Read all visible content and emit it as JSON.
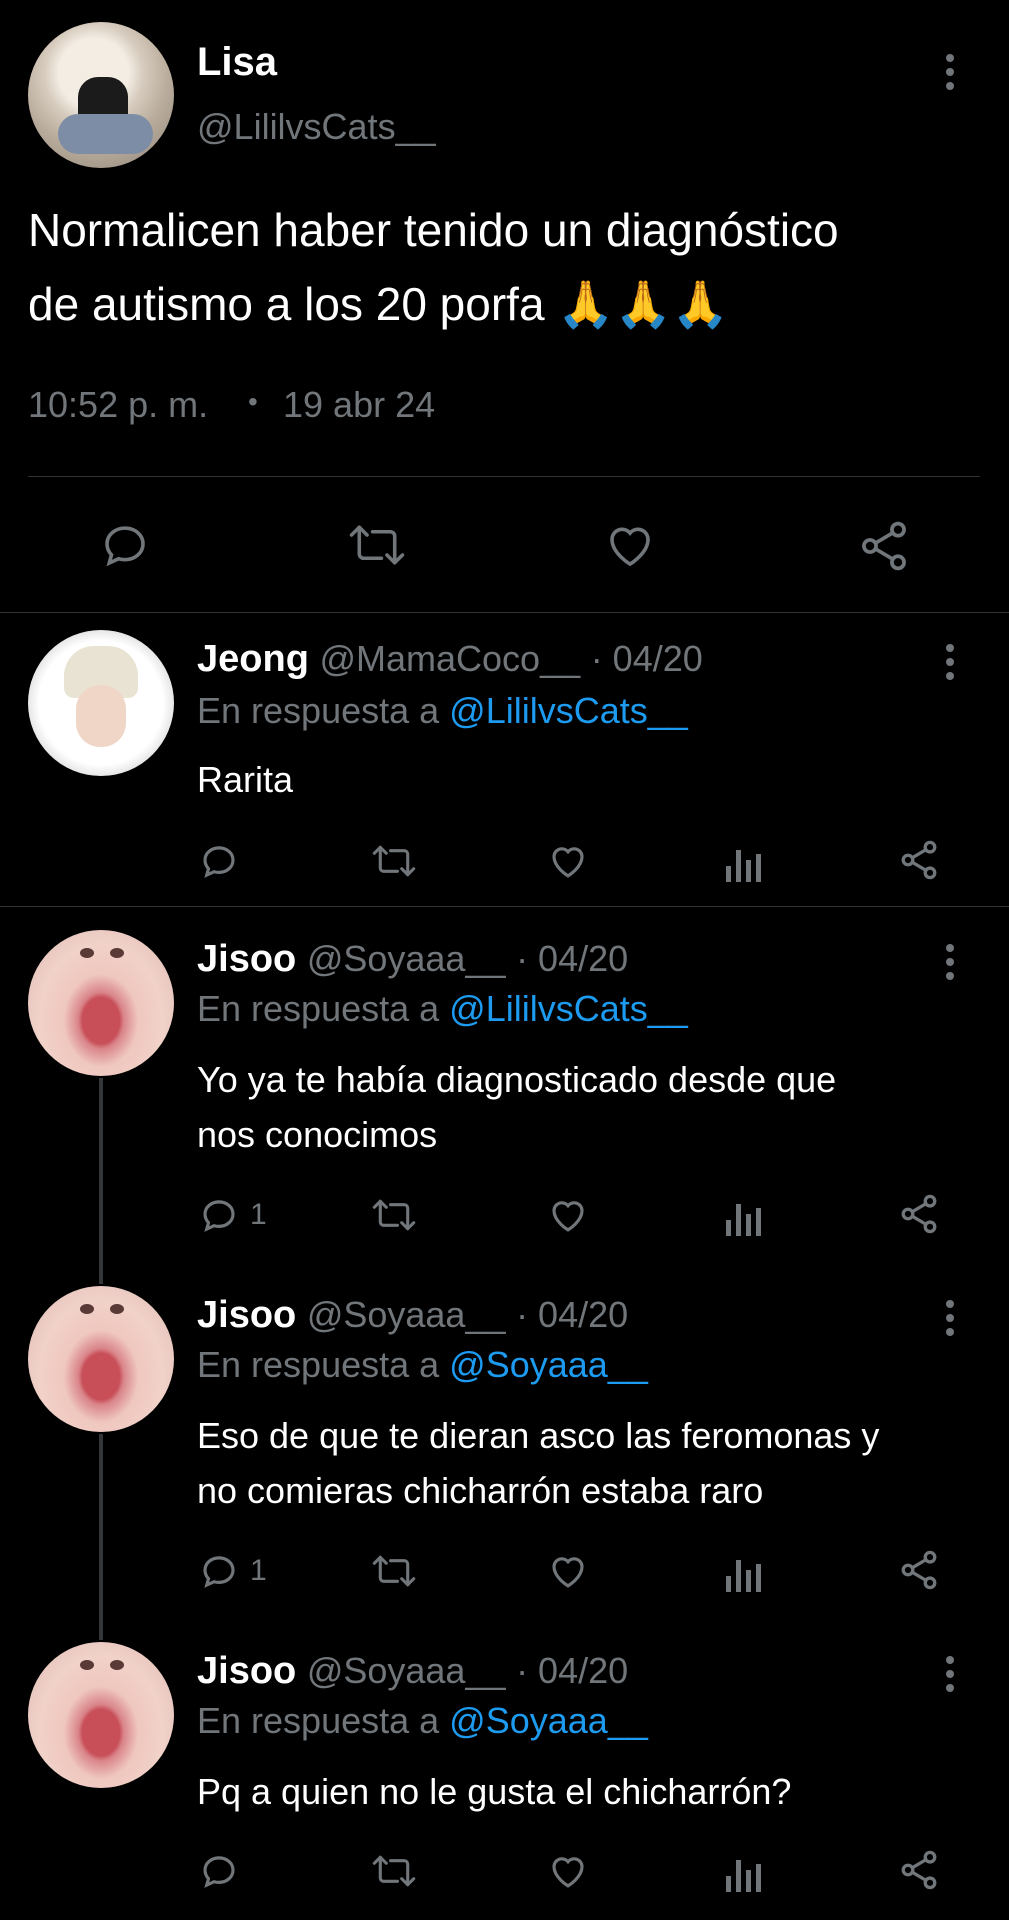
{
  "main_tweet": {
    "author_name": "Lisa",
    "author_handle": "@LililvsCats__",
    "text": "Normalicen haber tenido un diagnóstico\nde autismo a los 20 porfa 🙏🙏🙏",
    "text_line1": "Normalicen haber tenido un diagnóstico",
    "text_line2": "de autismo a los 20 porfa",
    "emoji": "🙏🙏🙏",
    "time": "10:52 p. m.",
    "separator": "•",
    "date": "19 abr 24"
  },
  "replies": [
    {
      "name": "Jeong",
      "handle": "@MamaCoco__",
      "date": "· 04/20",
      "reply_prefix": "En respuesta a",
      "reply_to": "@LililvsCats__",
      "text_line1": "Rarita",
      "reply_count": "",
      "avatar": "jeong"
    },
    {
      "name": "Jisoo",
      "handle": "@Soyaaa__",
      "date": "· 04/20",
      "reply_prefix": "En respuesta a",
      "reply_to": "@LililvsCats__",
      "text_line1": "Yo ya te había diagnosticado desde que",
      "text_line2": "nos conocimos",
      "reply_count": "1",
      "avatar": "jisoo"
    },
    {
      "name": "Jisoo",
      "handle": "@Soyaaa__",
      "date": "· 04/20",
      "reply_prefix": "En respuesta a",
      "reply_to": "@Soyaaa__",
      "text_line1": "Eso de que te dieran asco las feromonas y",
      "text_line2": "no comieras chicharrón estaba raro",
      "reply_count": "1",
      "avatar": "jisoo"
    },
    {
      "name": "Jisoo",
      "handle": "@Soyaaa__",
      "date": "· 04/20",
      "reply_prefix": "En respuesta a",
      "reply_to": "@Soyaaa__",
      "text_line1": "Pq a quien no le gusta el chicharrón?",
      "reply_count": "",
      "avatar": "jisoo"
    }
  ],
  "icons": {
    "reply": "reply-icon",
    "retweet": "retweet-icon",
    "like": "like-icon",
    "views": "views-icon",
    "share": "share-icon",
    "more": "more-vertical-icon"
  },
  "colors": {
    "background": "#000000",
    "text": "#e7e9ea",
    "muted": "#71767b",
    "link": "#1d9bf0",
    "divider": "#2f3336"
  }
}
